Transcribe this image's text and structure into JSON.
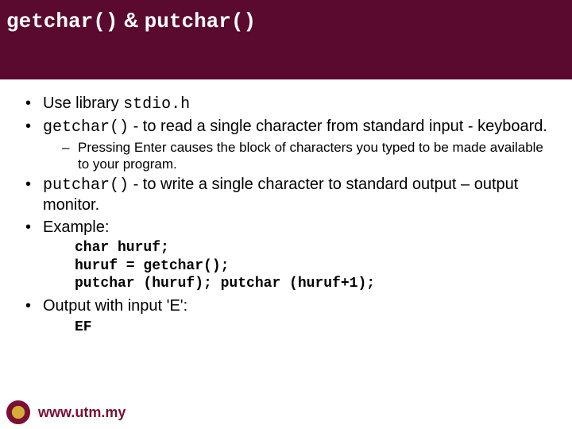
{
  "title": {
    "part1": "getchar()",
    "amp": " & ",
    "part2": "putchar()"
  },
  "bullets": {
    "b1_pre": "Use library ",
    "b1_code": "stdio.h",
    "b2_code": "getchar()",
    "b2_rest": " - to read a single character from standard input - keyboard.",
    "b2_sub": "Pressing Enter causes the block of characters you typed to be made available to your program.",
    "b3_code": "putchar()",
    "b3_rest": " - to write a single character to standard output – output monitor.",
    "b4": "Example:",
    "code": "char huruf;\nhuruf = getchar();\nputchar (huruf); putchar (huruf+1);",
    "b5": "Output with input 'E':",
    "output": "EF"
  },
  "footer": {
    "url": "www.utm.my"
  }
}
